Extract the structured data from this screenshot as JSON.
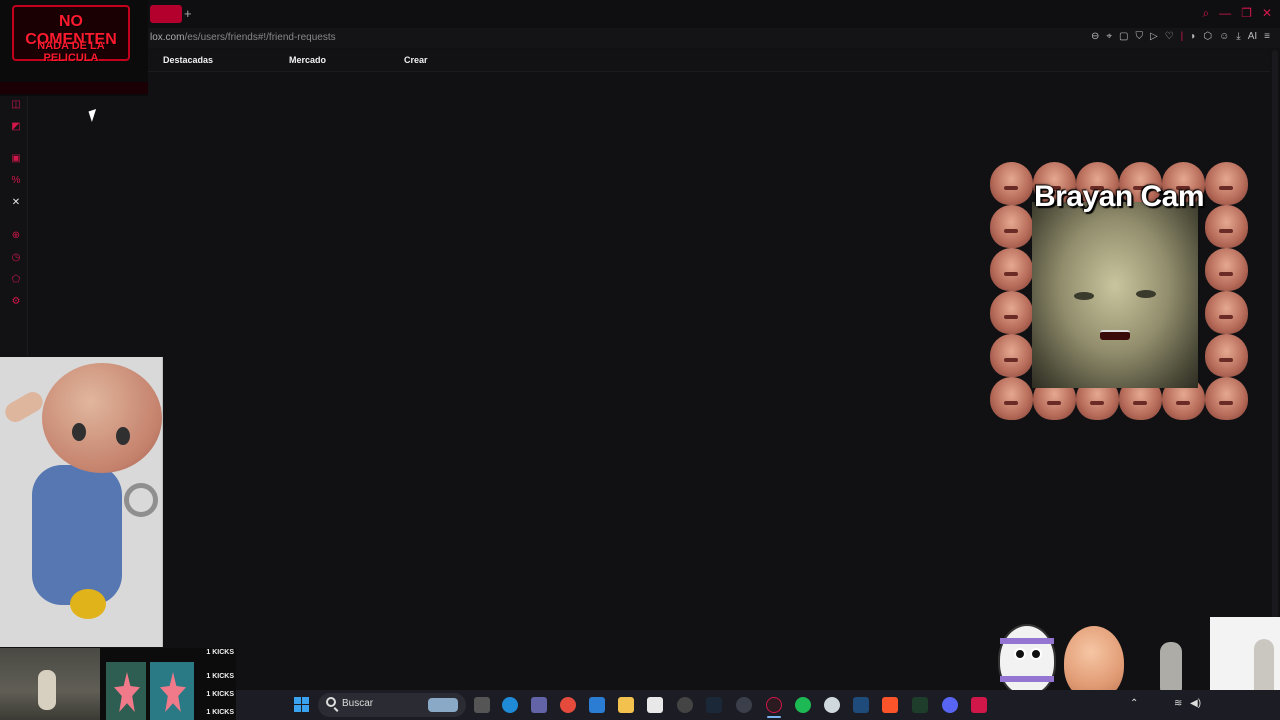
{
  "browser": {
    "url_domain": "lox.com",
    "url_path": "/es/users/friends#!/friend-requests",
    "new_tab_symbol": "+",
    "accent_color": "#d1164a"
  },
  "page": {
    "nav": [
      "Destacadas",
      "Mercado",
      "Crear"
    ]
  },
  "banner": {
    "line1": "NO COMENTEN",
    "line2": "NADA DE LA PELICULA"
  },
  "webcam": {
    "title": "Brayan Cam"
  },
  "kicks": [
    "1 KICKS",
    "1 KICKS",
    "1 KICKS",
    "1 KICKS"
  ],
  "taskbar": {
    "search_placeholder": "Buscar",
    "ai_label": "AI"
  }
}
